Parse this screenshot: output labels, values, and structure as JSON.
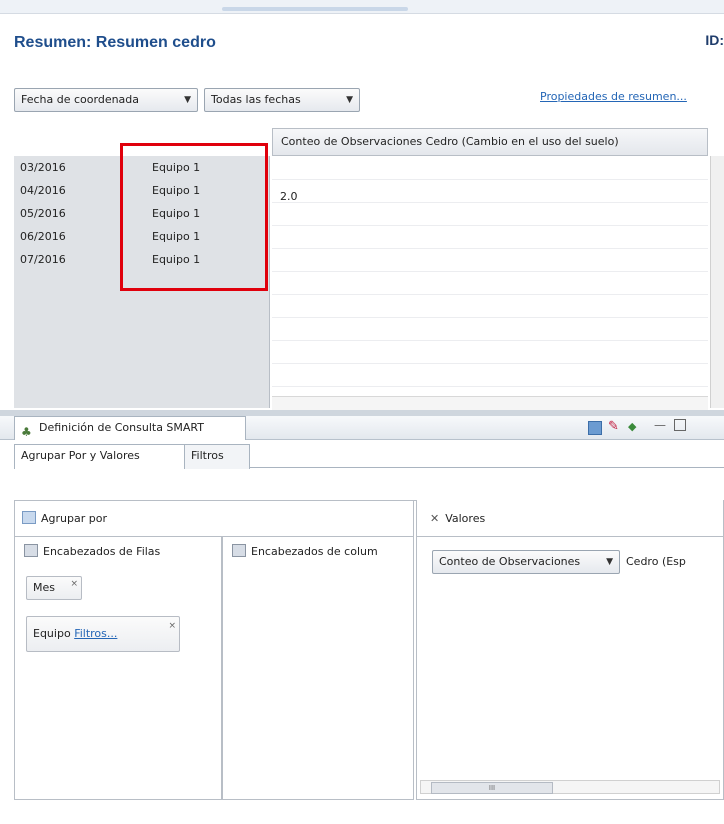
{
  "summary": {
    "title": "Resumen:  Resumen cedro",
    "id_label": "ID:",
    "date_combo": "Fecha de coordenada",
    "range_combo": "Todas las fechas",
    "properties_link": "Propiedades de resumen..."
  },
  "grid": {
    "column_header": "Conteo de Observaciones  Cedro (Cambio en el uso del suelo)",
    "rows": [
      {
        "month": "03/2016",
        "team": "Equipo 1",
        "value": ""
      },
      {
        "month": "04/2016",
        "team": "Equipo 1",
        "value": "2.0"
      },
      {
        "month": "05/2016",
        "team": "Equipo 1",
        "value": ""
      },
      {
        "month": "06/2016",
        "team": "Equipo 1",
        "value": ""
      },
      {
        "month": "07/2016",
        "team": "Equipo 1",
        "value": ""
      }
    ]
  },
  "query_panel": {
    "tab_label": "Definición de Consulta SMART",
    "subtab_group": "Agrupar Por y Valores",
    "subtab_filters": "Filtros",
    "group_by_label": "Agrupar por",
    "row_headers_label": "Encabezados de Filas",
    "column_headers_label": "Encabezados de colum",
    "chip_month": "Mes",
    "chip_team": "Equipo",
    "chip_team_link": "Filtros...",
    "values_label": "Valores",
    "values_combo": "Conteo de Observaciones",
    "values_text": "Cedro (Esp",
    "hscroll_thumb": "III"
  },
  "colors": {
    "title_blue": "#1f4e8c",
    "link_blue": "#2466b6",
    "highlight_red": "#e0000c"
  }
}
